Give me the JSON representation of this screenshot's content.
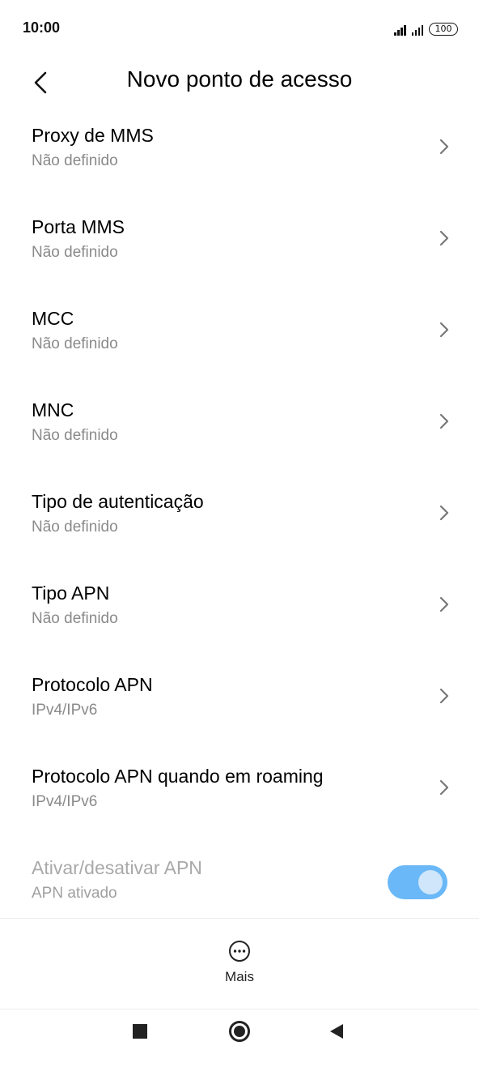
{
  "status_bar": {
    "time": "10:00",
    "battery": "100"
  },
  "header": {
    "title": "Novo ponto de acesso",
    "back_icon": "chevron-left-icon"
  },
  "settings": [
    {
      "title": "Proxy de MMS",
      "value": "Não definido"
    },
    {
      "title": "Porta MMS",
      "value": "Não definido"
    },
    {
      "title": "MCC",
      "value": "Não definido"
    },
    {
      "title": "MNC",
      "value": "Não definido"
    },
    {
      "title": "Tipo de autenticação",
      "value": "Não definido"
    },
    {
      "title": "Tipo APN",
      "value": "Não definido"
    },
    {
      "title": "Protocolo APN",
      "value": "IPv4/IPv6"
    },
    {
      "title": "Protocolo APN quando em roaming",
      "value": "IPv4/IPv6"
    }
  ],
  "apn_toggle": {
    "title": "Ativar/desativar APN",
    "value": "APN ativado",
    "enabled": true,
    "accent_color": "#6ab8f7"
  },
  "bottom_action": {
    "label": "Mais",
    "icon": "more-horizontal-icon"
  },
  "nav_bar": {
    "recents_icon": "square-icon",
    "home_icon": "circle-icon",
    "back_icon": "triangle-back-icon"
  }
}
